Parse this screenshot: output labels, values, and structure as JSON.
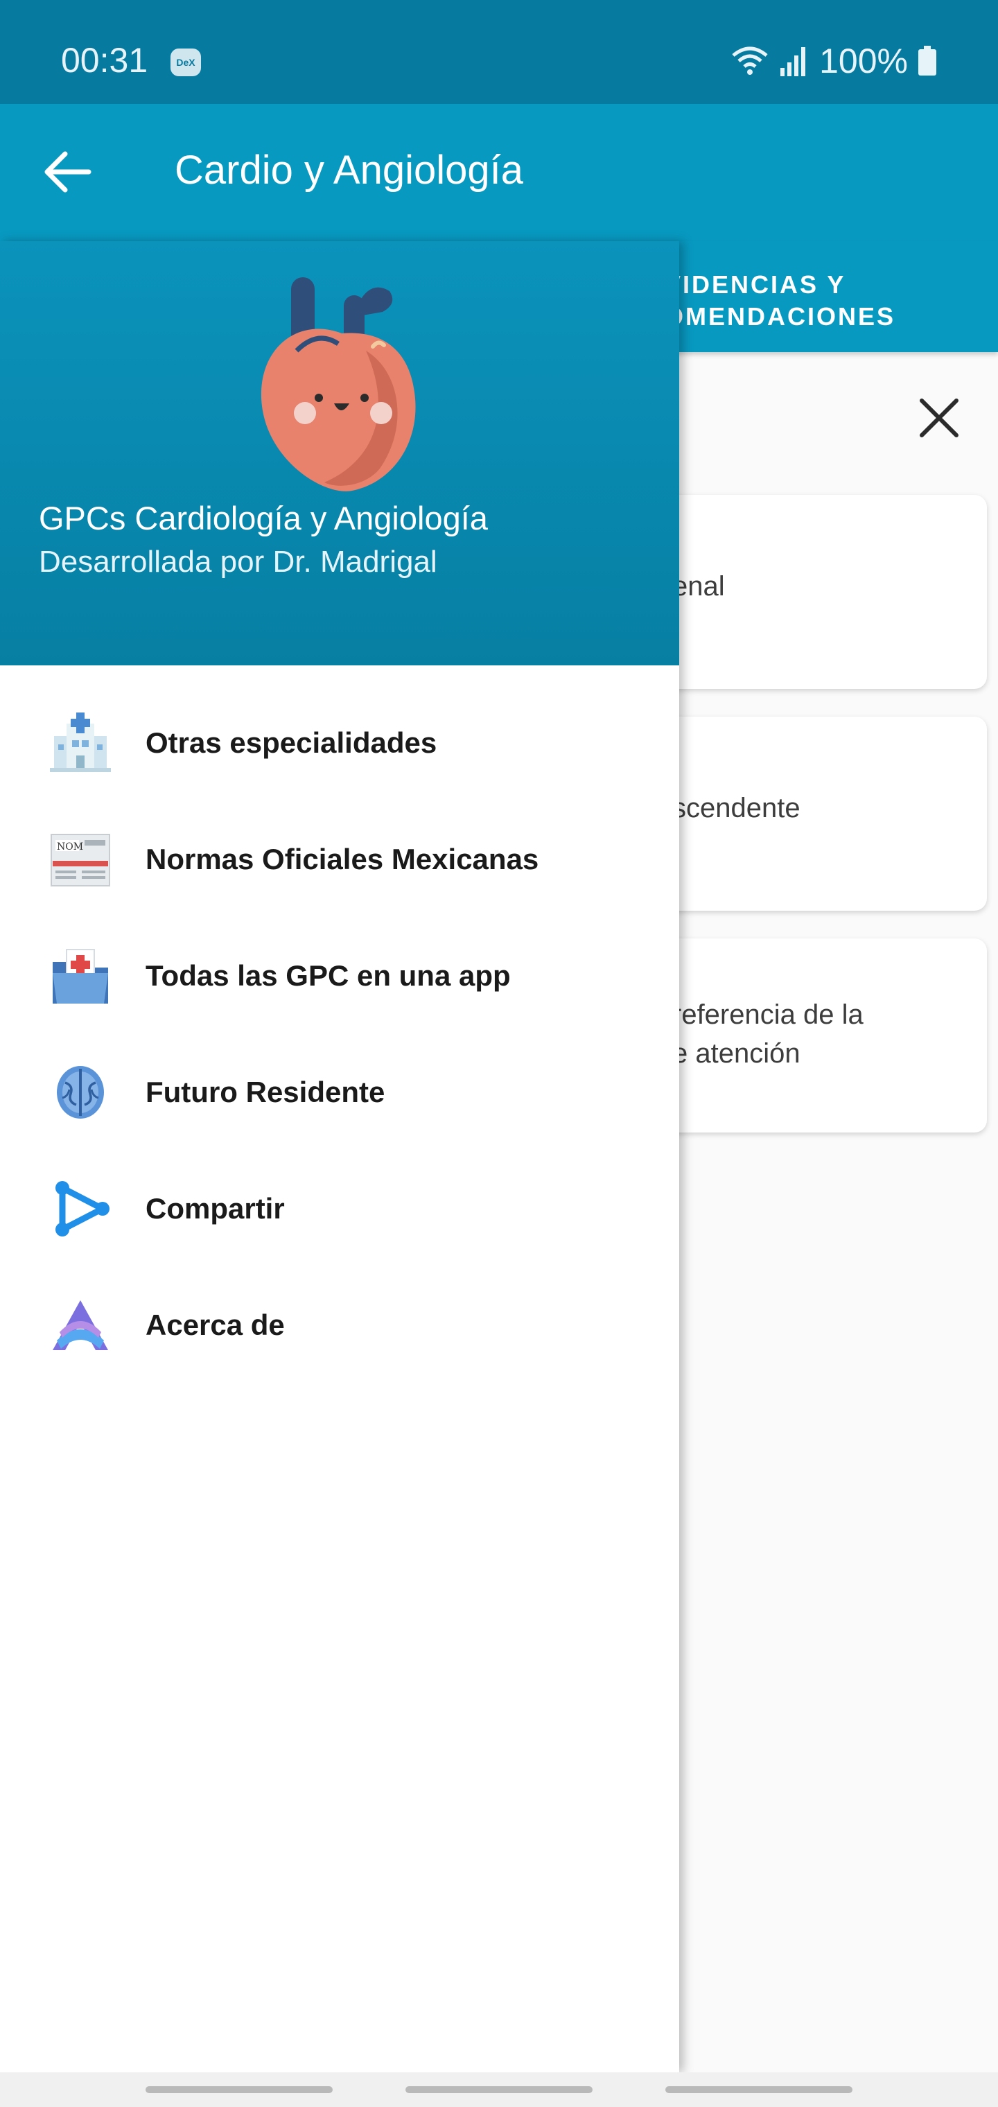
{
  "status_bar": {
    "time": "00:31",
    "dex_label": "DeX",
    "battery": "100%",
    "icons": [
      "wifi-icon",
      "signal-icon",
      "battery-icon"
    ]
  },
  "app_bar": {
    "title": "Cardio y Angiología",
    "back_icon": "arrow-left-icon"
  },
  "background": {
    "tab_label_line1": "VIDENCIAS Y",
    "tab_label_line2": "OMENDACIONES",
    "close_icon": "close-icon",
    "cards": [
      {
        "lines": [
          "enal"
        ]
      },
      {
        "lines": [
          "scendente"
        ]
      },
      {
        "lines": [
          "referencia de la",
          "e atención"
        ]
      }
    ]
  },
  "drawer": {
    "title": "GPCs Cardiología y Angiología",
    "subtitle": "Desarrollada por Dr. Madrigal",
    "items": [
      {
        "label": "Otras especialidades",
        "icon": "hospital-icon"
      },
      {
        "label": "Normas Oficiales Mexicanas",
        "icon": "newspaper-icon"
      },
      {
        "label": "Todas las GPC en una app",
        "icon": "medical-folder-icon"
      },
      {
        "label": "Futuro Residente",
        "icon": "brain-icon"
      },
      {
        "label": "Compartir",
        "icon": "share-icon"
      },
      {
        "label": "Acerca de",
        "icon": "about-logo-icon"
      }
    ]
  },
  "colors": {
    "status_bar": "#077aa0",
    "app_bar": "#0899c1",
    "drawer_header": "#077fa3"
  }
}
